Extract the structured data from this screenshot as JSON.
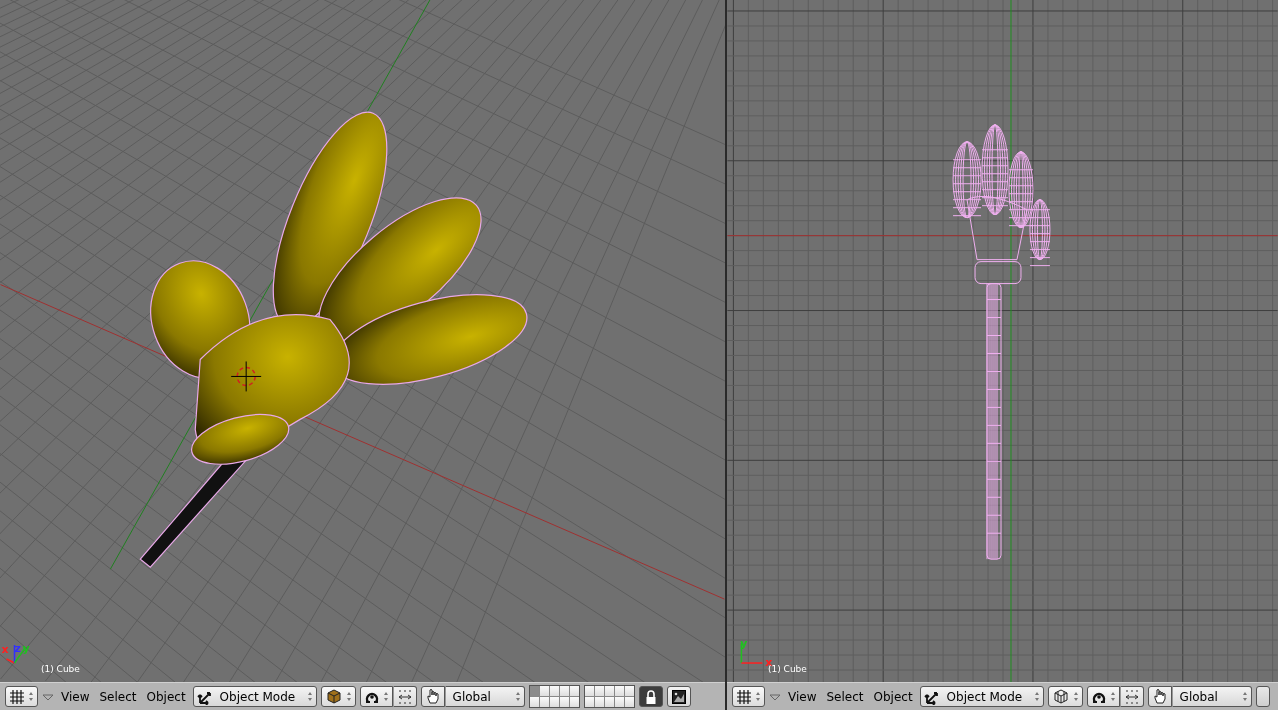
{
  "viewports": [
    {
      "kind": "perspective",
      "wireframe": false,
      "axes": [
        {
          "label": "x",
          "color": "#ff2020"
        },
        {
          "label": "z",
          "color": "#3030ff"
        },
        {
          "label": "y",
          "color": "#20c020"
        }
      ],
      "object_label": "(1) Cube",
      "header": {
        "menus": [
          "View",
          "Select",
          "Object"
        ],
        "mode": "Object Mode",
        "orientation": "Global",
        "layers": [
          {
            "selected": true
          },
          {
            "selected": false
          },
          {
            "selected": false
          },
          {
            "selected": false
          },
          {
            "selected": false
          },
          {
            "selected": false
          },
          {
            "selected": false
          },
          {
            "selected": false
          },
          {
            "selected": false
          },
          {
            "selected": false
          },
          {
            "selected": false
          },
          {
            "selected": false
          },
          {
            "selected": false
          },
          {
            "selected": false
          },
          {
            "selected": false
          },
          {
            "selected": false
          },
          {
            "selected": false
          },
          {
            "selected": false
          },
          {
            "selected": false
          },
          {
            "selected": false
          }
        ],
        "locked": true
      }
    },
    {
      "kind": "ortho",
      "wireframe": true,
      "axes": [
        {
          "label": "y",
          "color": "#20c020"
        },
        {
          "label": "x",
          "color": "#ff2020"
        }
      ],
      "object_label": "(1) Cube",
      "header": {
        "menus": [
          "View",
          "Select",
          "Object"
        ],
        "mode": "Object Mode",
        "orientation": "Global"
      }
    }
  ]
}
